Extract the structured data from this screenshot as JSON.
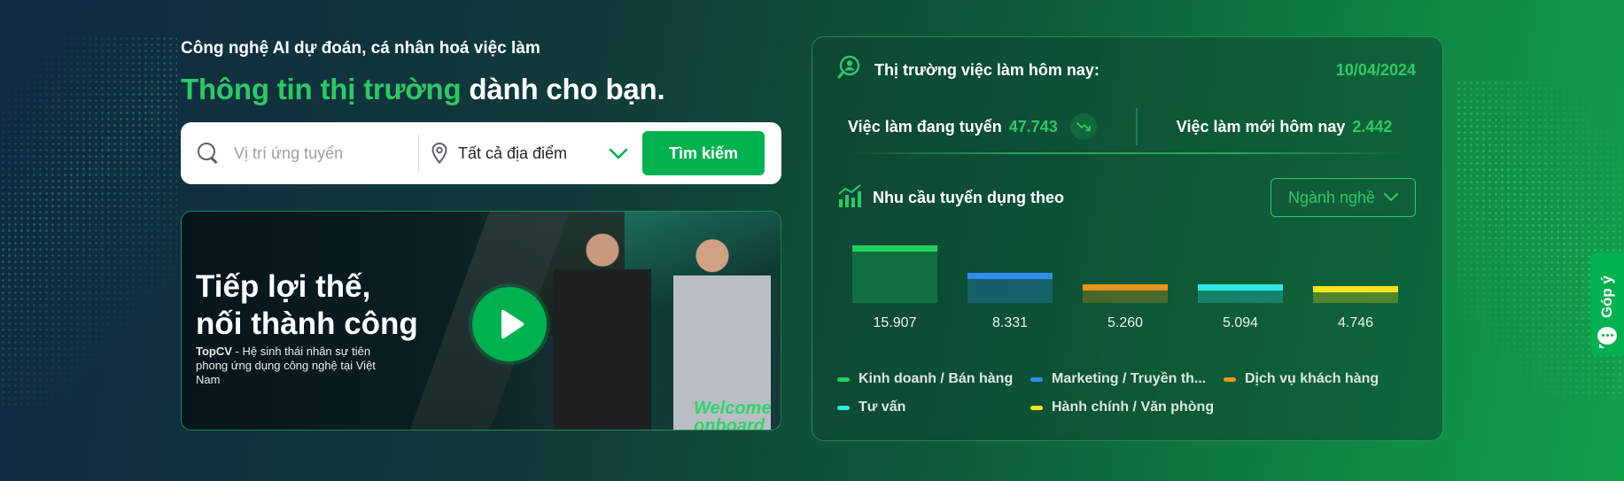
{
  "hero": {
    "tagline": "Công nghệ AI dự đoán, cá nhân hoá việc làm",
    "headline_highlight": "Thông tin thị trường",
    "headline_rest": " dành cho bạn."
  },
  "search": {
    "placeholder": "Vị trí ứng tuyển",
    "location_value": "Tất cả địa điểm",
    "button_label": "Tìm kiếm"
  },
  "banner": {
    "title_line1": "Tiếp lợi thế,",
    "title_line2": "nối thành công",
    "brand": "TopCV",
    "subtitle": " - Hệ sinh thái nhân sự tiên phong ứng dụng công nghệ tại Việt Nam",
    "welcome_line1": "Welcome",
    "welcome_line2": "onboard"
  },
  "market": {
    "title": "Thị trường việc làm hôm nay:",
    "date": "10/04/2024",
    "open_jobs_label": "Việc làm đang tuyển",
    "open_jobs_value": "47.743",
    "new_jobs_label": "Việc làm mới hôm nay",
    "new_jobs_value": "2.442"
  },
  "demand": {
    "label": "Nhu cầu tuyển dụng theo",
    "dropdown_value": "Ngành nghề"
  },
  "chart_data": {
    "type": "bar",
    "categories": [
      "Kinh doanh / Bán hàng",
      "Marketing / Truyền th...",
      "Dịch vụ khách hàng",
      "Tư vấn",
      "Hành chính / Văn phòng"
    ],
    "values": [
      15907,
      8331,
      5260,
      5094,
      4746
    ],
    "value_labels": [
      "15.907",
      "8.331",
      "5.260",
      "5.094",
      "4.746"
    ],
    "colors": [
      "#22d060",
      "#2f8ef0",
      "#e8961a",
      "#2fe8e8",
      "#f7e41a"
    ]
  },
  "feedback": {
    "label": "Góp ý"
  }
}
